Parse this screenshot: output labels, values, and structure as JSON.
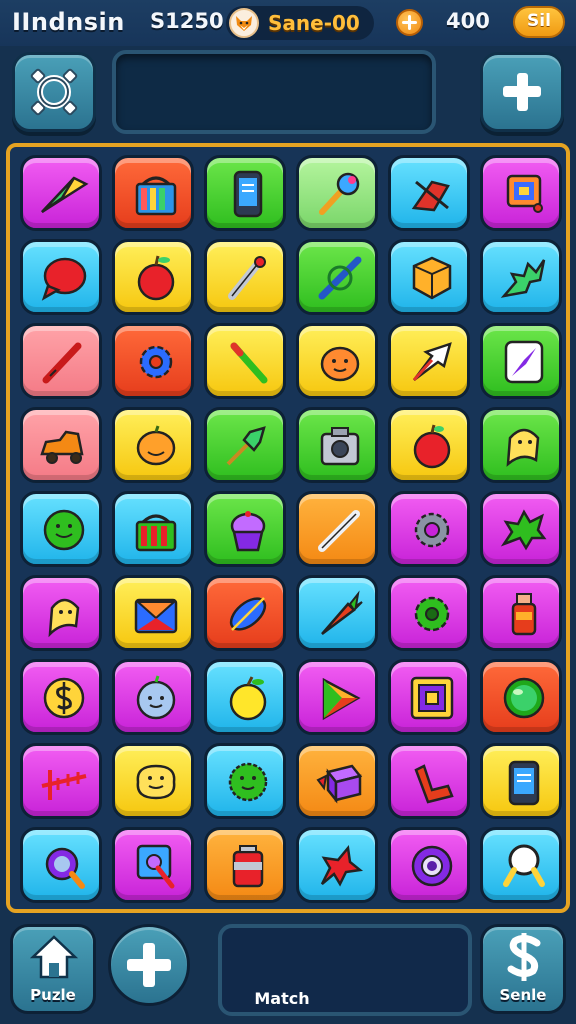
{
  "status_bar": {
    "title": "IIndnsin",
    "coins": "S1250",
    "player_name": "Sane-00",
    "gems": "400",
    "sell_label": "Sil"
  },
  "bottom_nav": {
    "home_label": "Puzle",
    "match_label": "Match",
    "money_label": "Senle"
  },
  "board": {
    "rows": 9,
    "cols": 6,
    "tiles": [
      [
        "wedge-icon",
        "basket-icon",
        "phone-icon",
        "wand-icon",
        "slash-arrow-icon",
        "robot-icon"
      ],
      [
        "speech-bubble-icon",
        "apple-icon",
        "torch-icon",
        "rolling-pin-icon",
        "cube-icon",
        "leaf-icon"
      ],
      [
        "pen-icon",
        "gear-icon",
        "pencil-icon",
        "pumpkin-icon",
        "arrow-icon",
        "compass-icon"
      ],
      [
        "car-icon",
        "pumpkin-icon",
        "arrow-icon",
        "camera-icon",
        "apple-icon",
        "ghost-icon"
      ],
      [
        "smiley-icon",
        "basket-icon",
        "cupcake-icon",
        "pencil-icon",
        "gear-icon",
        "splat-icon"
      ],
      [
        "ghost-icon",
        "envelope-icon",
        "leaf-icon",
        "carrot-icon",
        "cog-icon",
        "bottle-icon"
      ],
      [
        "coin-icon",
        "face-icon",
        "apple-icon",
        "triangle-icon",
        "square-icon",
        "gem-icon"
      ],
      [
        "ruler-icon",
        "face-icon",
        "spiky-ball-icon",
        "gift-icon",
        "boot-icon",
        "phone-icon"
      ],
      [
        "magnifier-icon",
        "magnifier-icon",
        "can-icon",
        "star-icon",
        "ring-icon",
        "magnifier-icon"
      ]
    ]
  }
}
